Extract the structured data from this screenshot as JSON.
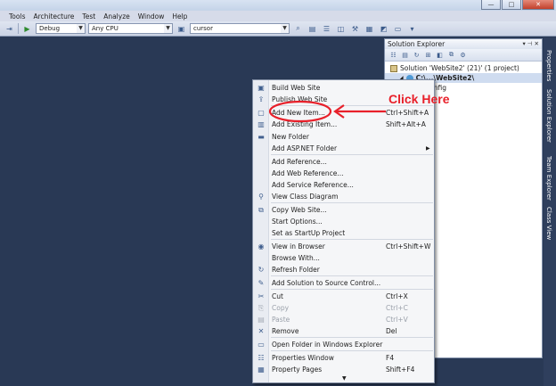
{
  "window": {
    "minimize": "—",
    "maximize": "□",
    "close": "✕"
  },
  "menubar": [
    "Tools",
    "Architecture",
    "Test",
    "Analyze",
    "Window",
    "Help"
  ],
  "toolbar": {
    "config": "Debug",
    "platform": "Any CPU",
    "find": "cursor"
  },
  "side_tabs": [
    "Properties",
    "Solution Explorer",
    "Team Explorer",
    "Class View"
  ],
  "solution_explorer": {
    "title": "Solution Explorer",
    "controls": "▾ ⊣ ✕",
    "tree": [
      {
        "label": "Solution 'WebSite2' (21)' (1 project)",
        "icon": "solution-icon"
      },
      {
        "label": "C:\\...\\WebSite2\\",
        "icon": "website-icon"
      },
      {
        "label": "config",
        "icon": "config-file-icon"
      }
    ]
  },
  "context_menu": {
    "items": [
      {
        "label": "Build Web Site",
        "shortcut": "",
        "icon": "build-icon"
      },
      {
        "label": "Publish Web Site",
        "shortcut": "",
        "icon": "publish-icon"
      },
      {
        "label": "Add New Item...",
        "shortcut": "Ctrl+Shift+A",
        "icon": "new-item-icon"
      },
      {
        "label": "Add Existing Item...",
        "shortcut": "Shift+Alt+A",
        "icon": "existing-item-icon"
      },
      {
        "label": "New Folder",
        "shortcut": "",
        "icon": "folder-icon"
      },
      {
        "label": "Add ASP.NET Folder",
        "shortcut": "",
        "icon": "",
        "submenu": "▶"
      },
      {
        "label": "Add Reference...",
        "shortcut": "",
        "icon": ""
      },
      {
        "label": "Add Web Reference...",
        "shortcut": "",
        "icon": ""
      },
      {
        "label": "Add Service Reference...",
        "shortcut": "",
        "icon": ""
      },
      {
        "label": "View Class Diagram",
        "shortcut": "",
        "icon": "class-diagram-icon"
      },
      {
        "label": "Copy Web Site...",
        "shortcut": "",
        "icon": "copy-web-icon"
      },
      {
        "label": "Start Options...",
        "shortcut": "",
        "icon": ""
      },
      {
        "label": "Set as StartUp Project",
        "shortcut": "",
        "icon": ""
      },
      {
        "label": "View in Browser",
        "shortcut": "Ctrl+Shift+W",
        "icon": "browser-icon"
      },
      {
        "label": "Browse With...",
        "shortcut": "",
        "icon": ""
      },
      {
        "label": "Refresh Folder",
        "shortcut": "",
        "icon": "refresh-icon"
      },
      {
        "label": "Add Solution to Source Control...",
        "shortcut": "",
        "icon": "source-control-icon"
      },
      {
        "label": "Cut",
        "shortcut": "Ctrl+X",
        "icon": "cut-icon"
      },
      {
        "label": "Copy",
        "shortcut": "Ctrl+C",
        "icon": "copy-icon",
        "disabled": true
      },
      {
        "label": "Paste",
        "shortcut": "Ctrl+V",
        "icon": "paste-icon",
        "disabled": true
      },
      {
        "label": "Remove",
        "shortcut": "Del",
        "icon": "remove-icon"
      },
      {
        "label": "Open Folder in Windows Explorer",
        "shortcut": "",
        "icon": "open-folder-icon"
      },
      {
        "label": "Properties Window",
        "shortcut": "F4",
        "icon": "properties-icon"
      },
      {
        "label": "Property Pages",
        "shortcut": "Shift+F4",
        "icon": "property-pages-icon"
      }
    ],
    "scroll_down": "▼"
  },
  "annotation": {
    "text": "Click Here",
    "color": "#e8202a"
  }
}
